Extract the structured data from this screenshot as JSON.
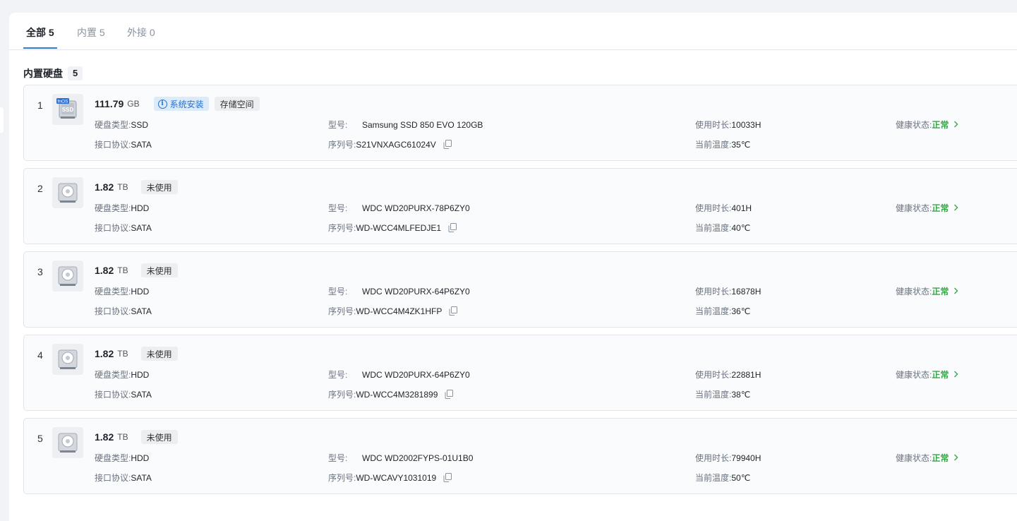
{
  "tabs": [
    {
      "label": "全部 5"
    },
    {
      "label": "内置 5"
    },
    {
      "label": "外接 0"
    }
  ],
  "section": {
    "title": "内置硬盘",
    "count": "5"
  },
  "labels": {
    "disk_type": "硬盘类型:",
    "model": "型号:",
    "usage_time": "使用时长:",
    "health": "健康状态:",
    "interface": "接口协议:",
    "serial": "序列号:",
    "temperature": "当前温度:"
  },
  "disks": [
    {
      "index": "1",
      "capacity": "111.79",
      "unit": "GB",
      "icon": "ssd-fnos-icon",
      "fnos_text": "fnOS",
      "tags": [
        {
          "label": "系统安装",
          "style": "blue",
          "icon": "info-icon"
        },
        {
          "label": "存储空间",
          "style": "gray"
        }
      ],
      "type": "SSD",
      "model": "Samsung SSD 850 EVO 120GB",
      "usage": "10033H",
      "health": "正常",
      "interface": "SATA",
      "serial": "S21VNXAGC61024V",
      "temp": "35℃"
    },
    {
      "index": "2",
      "capacity": "1.82",
      "unit": "TB",
      "icon": "hdd-icon",
      "tags": [
        {
          "label": "未使用",
          "style": "gray"
        }
      ],
      "type": "HDD",
      "model": "WDC WD20PURX-78P6ZY0",
      "usage": "401H",
      "health": "正常",
      "interface": "SATA",
      "serial": "WD-WCC4MLFEDJE1",
      "temp": "40℃"
    },
    {
      "index": "3",
      "capacity": "1.82",
      "unit": "TB",
      "icon": "hdd-icon",
      "tags": [
        {
          "label": "未使用",
          "style": "gray"
        }
      ],
      "type": "HDD",
      "model": "WDC WD20PURX-64P6ZY0",
      "usage": "16878H",
      "health": "正常",
      "interface": "SATA",
      "serial": "WD-WCC4M4ZK1HFP",
      "temp": "36℃"
    },
    {
      "index": "4",
      "capacity": "1.82",
      "unit": "TB",
      "icon": "hdd-icon",
      "tags": [
        {
          "label": "未使用",
          "style": "gray"
        }
      ],
      "type": "HDD",
      "model": "WDC WD20PURX-64P6ZY0",
      "usage": "22881H",
      "health": "正常",
      "interface": "SATA",
      "serial": "WD-WCC4M3281899",
      "temp": "38℃"
    },
    {
      "index": "5",
      "capacity": "1.82",
      "unit": "TB",
      "icon": "hdd-icon",
      "tags": [
        {
          "label": "未使用",
          "style": "gray"
        }
      ],
      "type": "HDD",
      "model": "WDC WD2002FYPS-01U1B0",
      "usage": "79940H",
      "health": "正常",
      "interface": "SATA",
      "serial": "WD-WCAVY1031019",
      "temp": "50℃"
    }
  ],
  "colors": {
    "accent": "#2f7fd8",
    "health_ok": "#3aa54a",
    "tag_blue_bg": "#dcebfa"
  }
}
